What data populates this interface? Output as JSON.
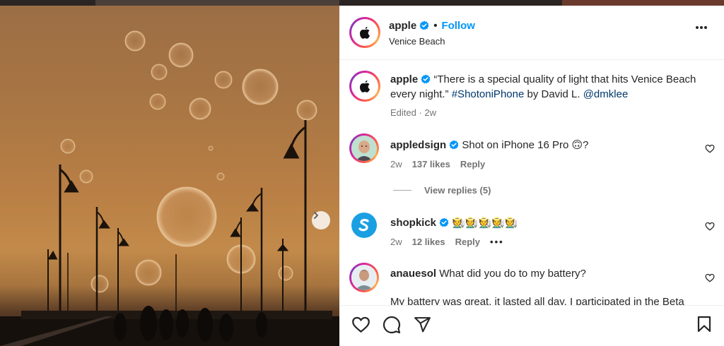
{
  "post": {
    "author": "apple",
    "follow_label": "Follow",
    "location": "Venice Beach",
    "caption_user": "apple",
    "caption_text": "“There is a special quality of light that hits Venice Beach every night.”",
    "caption_hashtag": "#ShotoniPhone",
    "caption_by": "by David L.",
    "caption_mention": "@dmklee",
    "caption_meta": "Edited · 2w"
  },
  "comments": [
    {
      "user": "appledsign",
      "text": "Shot on iPhone 16 Pro 🙃?",
      "time": "2w",
      "likes": "137 likes",
      "reply": "Reply"
    },
    {
      "user": "shopkick",
      "text": "🧑‍🌾🧑‍🌾🧑‍🌾🧑‍🌾🧑‍🌾",
      "time": "2w",
      "likes": "12 likes",
      "reply": "Reply"
    },
    {
      "user": "anauesol",
      "text": "What did you do to my battery?",
      "text2": "My battery was great, it lasted all day. I participated in the Beta"
    }
  ],
  "view_replies": "View replies (5)",
  "icons": {
    "verified": "verified-badge-icon",
    "more": "more-options-icon",
    "like": "heart-icon",
    "comment": "comment-icon",
    "share": "share-icon",
    "save": "bookmark-icon",
    "next": "chevron-right-icon"
  },
  "colors": {
    "accent": "#0095f6",
    "link": "#00376b",
    "verified": "#0095f6"
  }
}
